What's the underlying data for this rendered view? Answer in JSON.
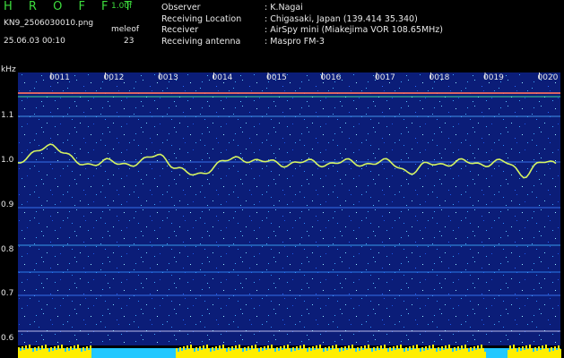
{
  "header": {
    "brand": "H R O F F T",
    "version": "1.00f",
    "filename": "KN9_2506030010.png",
    "timestamp": "25.06.03 00:10",
    "meleof_label": "meleof",
    "meleof_value": "23"
  },
  "info": [
    {
      "key": "Observer",
      "value": ": K.Nagai"
    },
    {
      "key": "Receiving Location",
      "value": ": Chigasaki, Japan (139.414 35.340)"
    },
    {
      "key": "Receiver",
      "value": ": AirSpy mini (Miakejima VOR 108.65MHz)"
    },
    {
      "key": "Receiving antenna",
      "value": ": Maspro FM-3"
    }
  ],
  "axis": {
    "unit": "kHz",
    "y_ticks": [
      "1.1",
      "1.0",
      "0.9",
      "0.8",
      "0.7",
      "0.6"
    ],
    "x_ticks": [
      "0011",
      "0012",
      "0013",
      "0014",
      "0015",
      "0016",
      "0017",
      "0018",
      "0019",
      "0020"
    ]
  },
  "colors": {
    "background": "#0a1a6e",
    "text": "#e8e8e8",
    "brand": "#3ddc3d",
    "signal": "#e0ff60",
    "bottom_bar": "#ffee00"
  }
}
